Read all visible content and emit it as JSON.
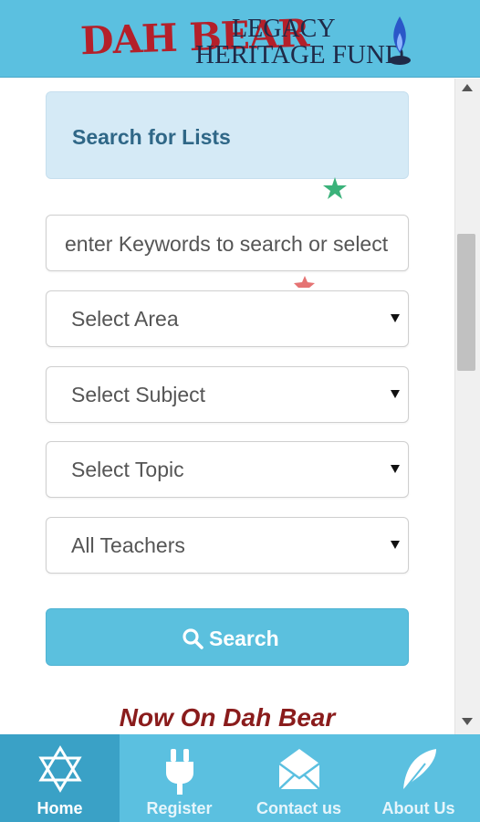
{
  "header": {
    "logo_main": "DAH BEAR",
    "logo_line1": "LEGACY",
    "logo_line2": "HERITAGE FUND",
    "brand_color": "#b4202a",
    "bar_color": "#5bc0e0"
  },
  "search_panel": {
    "title": "Search for Lists"
  },
  "form": {
    "keywords_placeholder": "enter Keywords to search or select",
    "area_selected": "Select Area",
    "subject_selected": "Select Subject",
    "topic_selected": "Select Topic",
    "teacher_selected": "All Teachers",
    "search_button_label": "Search",
    "search_icon": "search-icon"
  },
  "promo": {
    "heading": "Now On Dah Bear"
  },
  "bottom_nav": {
    "items": [
      {
        "label": "Home",
        "icon": "star-of-david-icon",
        "active": true
      },
      {
        "label": "Register",
        "icon": "plug-icon",
        "active": false
      },
      {
        "label": "Contact us",
        "icon": "envelope-icon",
        "active": false
      },
      {
        "label": "About Us",
        "icon": "feather-icon",
        "active": false
      }
    ]
  }
}
